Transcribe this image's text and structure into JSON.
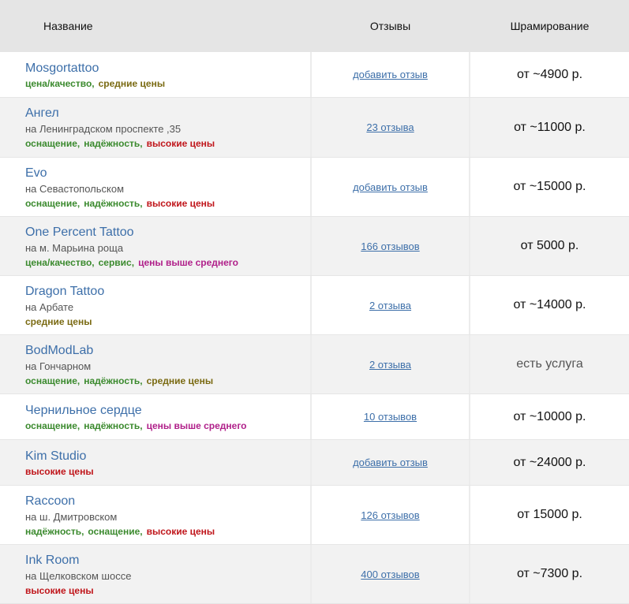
{
  "header": {
    "name": "Название",
    "reviews": "Отзывы",
    "price": "Шрамирование"
  },
  "rows": [
    {
      "title": "Mosgortattoo",
      "address": "",
      "tags": [
        {
          "text": "цена/качество,",
          "color": "g"
        },
        {
          "text": "средние цены",
          "color": "o"
        }
      ],
      "reviews": "добавить отзыв",
      "price": "от ~4900 р."
    },
    {
      "title": "Ангел",
      "address": "на Ленинградском проспекте ,35",
      "tags": [
        {
          "text": "оснащение,",
          "color": "g"
        },
        {
          "text": "надёжность,",
          "color": "g"
        },
        {
          "text": "высокие цены",
          "color": "r"
        }
      ],
      "reviews": "23 отзыва",
      "price": "от ~11000 р."
    },
    {
      "title": "Evo",
      "address": "на Севастопольском",
      "tags": [
        {
          "text": "оснащение,",
          "color": "g"
        },
        {
          "text": "надёжность,",
          "color": "g"
        },
        {
          "text": "высокие цены",
          "color": "r"
        }
      ],
      "reviews": "добавить отзыв",
      "price": "от ~15000 р."
    },
    {
      "title": "One Percent Tattoo",
      "address": "на м. Марьина роща",
      "tags": [
        {
          "text": "цена/качество,",
          "color": "g"
        },
        {
          "text": "сервис,",
          "color": "g"
        },
        {
          "text": "цены выше среднего",
          "color": "p"
        }
      ],
      "reviews": "166 отзывов",
      "price": "от 5000 р."
    },
    {
      "title": "Dragon Tattoo",
      "address": "на Арбате",
      "tags": [
        {
          "text": "средние цены",
          "color": "o"
        }
      ],
      "reviews": "2 отзыва",
      "price": "от ~14000 р."
    },
    {
      "title": "BodModLab",
      "address": "на Гончарном",
      "tags": [
        {
          "text": "оснащение,",
          "color": "g"
        },
        {
          "text": "надёжность,",
          "color": "g"
        },
        {
          "text": "средние цены",
          "color": "o"
        }
      ],
      "reviews": "2 отзыва",
      "price": "есть услуга"
    },
    {
      "title": "Чернильное сердце",
      "address": "",
      "tags": [
        {
          "text": "оснащение,",
          "color": "g"
        },
        {
          "text": "надёжность,",
          "color": "g"
        },
        {
          "text": "цены выше среднего",
          "color": "p"
        }
      ],
      "reviews": "10 отзывов",
      "price": "от ~10000 р."
    },
    {
      "title": "Kim Studio",
      "address": "",
      "tags": [
        {
          "text": "высокие цены",
          "color": "r"
        }
      ],
      "reviews": "добавить отзыв",
      "price": "от ~24000 р."
    },
    {
      "title": "Raccoon",
      "address": "на ш. Дмитровском",
      "tags": [
        {
          "text": "надёжность,",
          "color": "g"
        },
        {
          "text": "оснащение,",
          "color": "g"
        },
        {
          "text": "высокие цены",
          "color": "r"
        }
      ],
      "reviews": "126 отзывов",
      "price": "от 15000 р."
    },
    {
      "title": "Ink Room",
      "address": "на Щелковском шоссе",
      "tags": [
        {
          "text": "высокие цены",
          "color": "r"
        }
      ],
      "reviews": "400 отзывов",
      "price": "от ~7300 р."
    }
  ]
}
